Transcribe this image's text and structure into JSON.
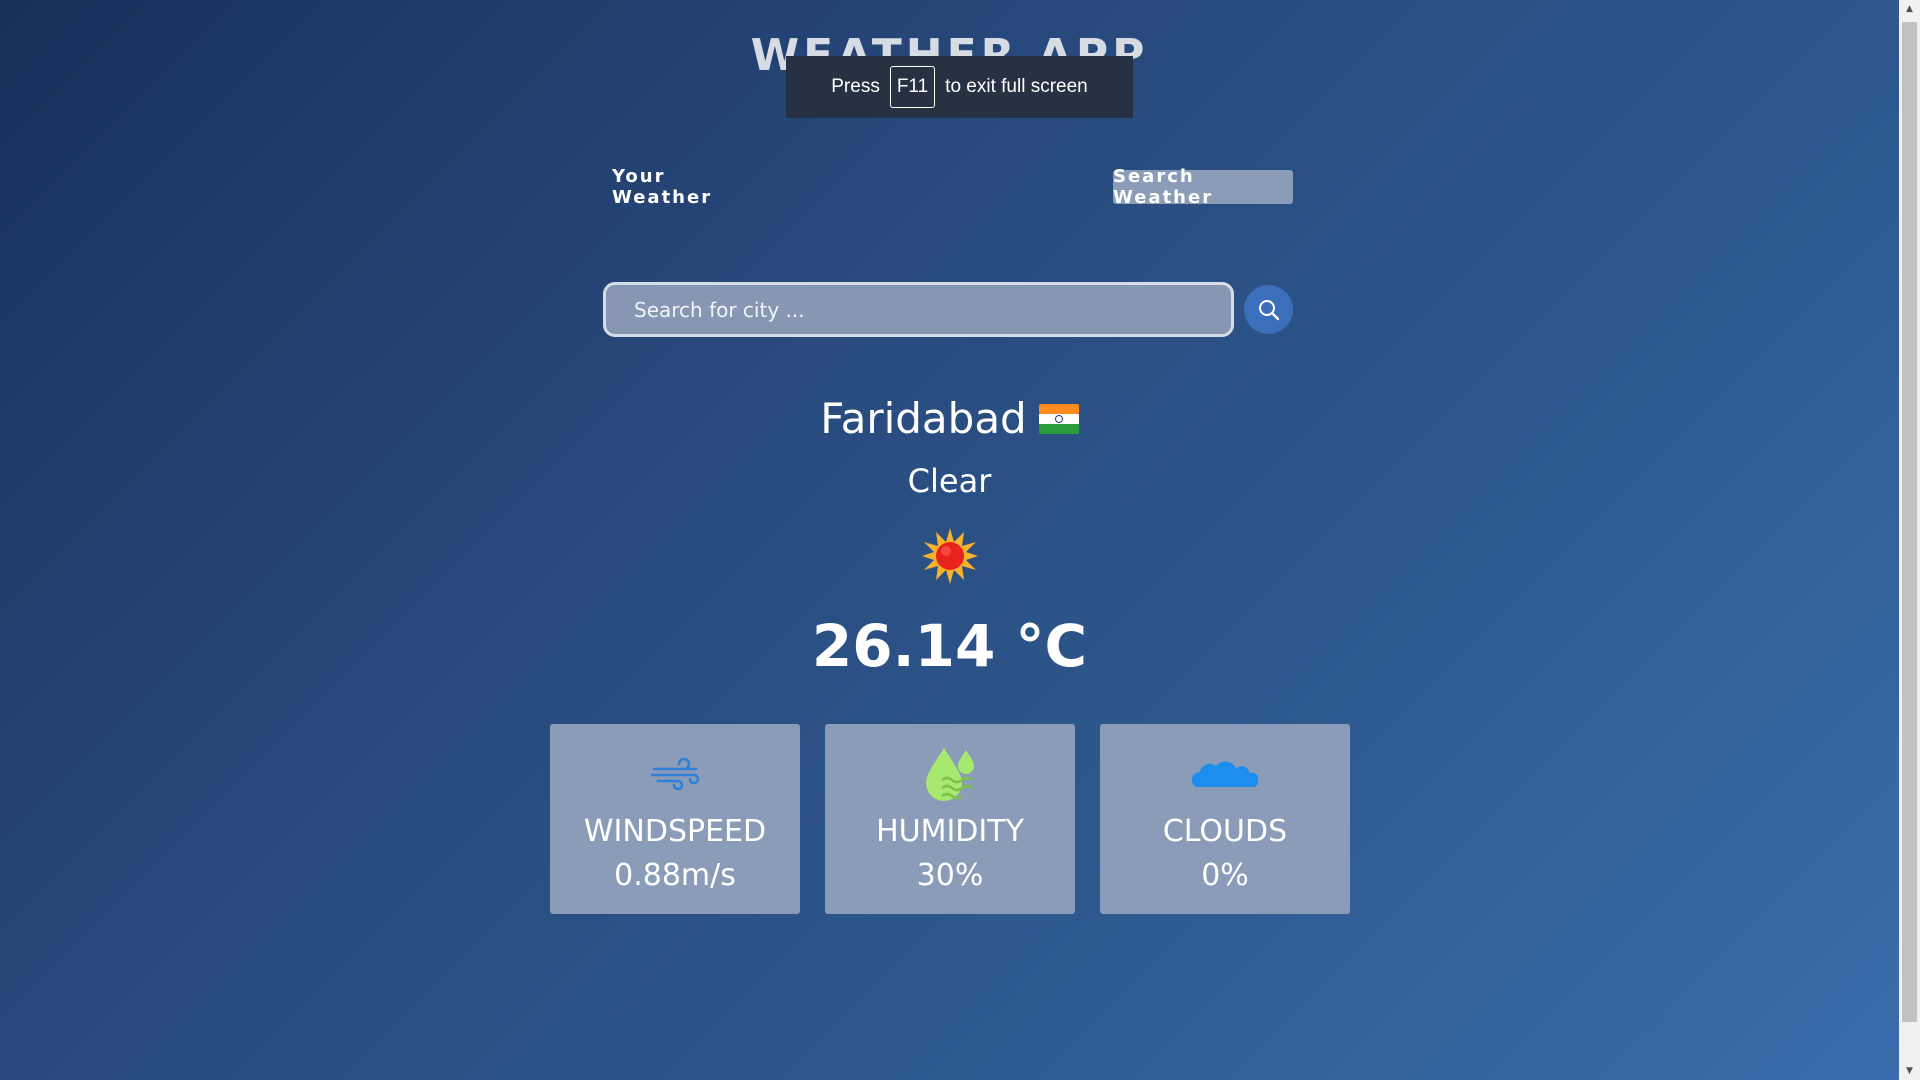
{
  "app": {
    "title": "WEATHER APP"
  },
  "fullscreen_notice": {
    "before": "Press",
    "key": "F11",
    "after": "to exit full screen"
  },
  "tabs": {
    "your_weather": "Your Weather",
    "search_weather": "Search Weather"
  },
  "search": {
    "placeholder": "Search for city ..."
  },
  "weather": {
    "city": "Faridabad",
    "flag": "🇮🇳",
    "condition": "Clear",
    "icon": "sun-icon",
    "temperature": "26.14 °C"
  },
  "stats": [
    {
      "label": "WINDSPEED",
      "value": "0.88m/s",
      "icon": "wind-icon"
    },
    {
      "label": "HUMIDITY",
      "value": "30%",
      "icon": "humidity-icon"
    },
    {
      "label": "CLOUDS",
      "value": "0%",
      "icon": "cloud-icon"
    }
  ],
  "colors": {
    "background_start": "#18305a",
    "background_end": "#3a6eae",
    "card": "#8a9cb8",
    "search_button": "#3c6fba",
    "wind_icon": "#2f7fd8",
    "humidity_icon": "#a7e86f",
    "cloud_icon": "#1d8df0"
  }
}
